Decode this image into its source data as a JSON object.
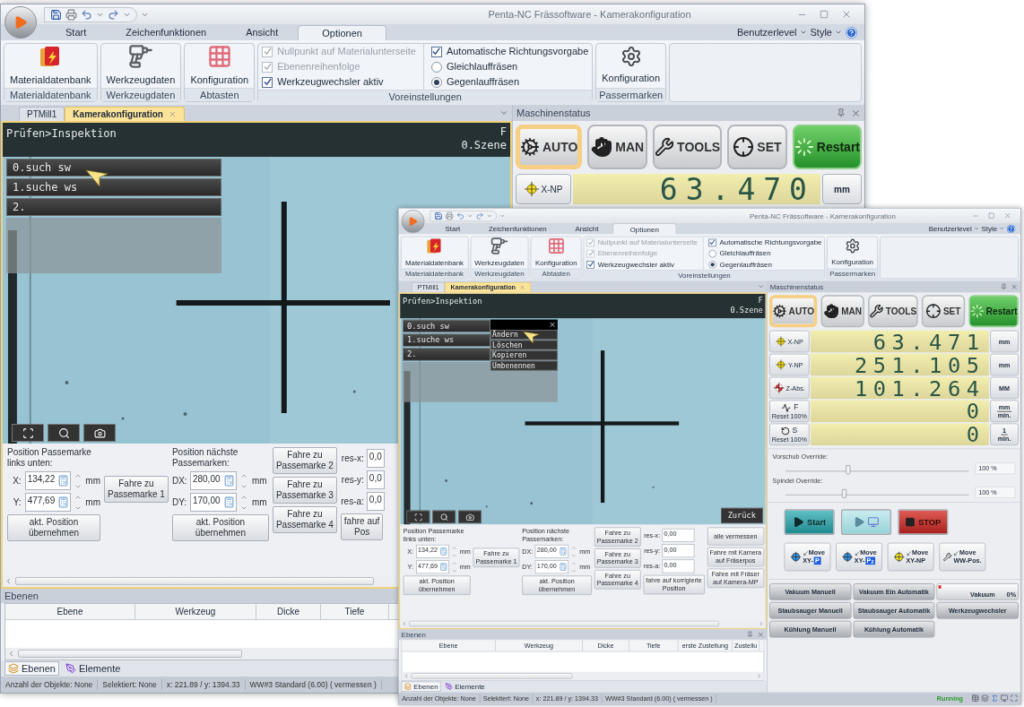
{
  "back_window": {
    "title": "Penta-NC Frässoftware - Kamerakonfiguration",
    "ribbon_tabs": [
      {
        "label": "Start",
        "selected": false
      },
      {
        "label": "Zeichenfunktionen",
        "selected": false
      },
      {
        "label": "Ansicht",
        "selected": false
      },
      {
        "label": "Optionen",
        "selected": true
      }
    ],
    "ribbon_right": [
      "Benutzerlevel",
      "Style"
    ],
    "ribbon_groups": [
      {
        "kind": "material",
        "label": "Materialdatenbank",
        "button": "Materialdatenbank"
      },
      {
        "kind": "tools",
        "label": "Werkzeugdaten",
        "button": "Werkzeugdaten"
      },
      {
        "kind": "probe",
        "label": "Abtasten",
        "button": "Konfiguration"
      },
      {
        "kind": "options",
        "label": "Voreinstellungen",
        "items": [
          {
            "kind": "checkbox",
            "label": "Nullpunkt auf Materialunterseite",
            "checked": true,
            "disabled": true
          },
          {
            "kind": "checkbox",
            "label": "Ebenenreihenfolge",
            "checked": true,
            "disabled": true
          },
          {
            "kind": "checkbox",
            "label": "Werkzeugwechsler aktiv",
            "checked": true,
            "disabled": false
          },
          {
            "kind": "checkbox",
            "label": "Automatische Richtungsvorgabe",
            "checked": true,
            "disabled": false
          },
          {
            "kind": "radio",
            "label": "Gleichlauffräsen",
            "selected": false
          },
          {
            "kind": "radio",
            "label": "Gegenlauffräsen",
            "selected": true
          }
        ]
      },
      {
        "kind": "marks",
        "label": "Passermarken",
        "button": "Konfiguration"
      }
    ],
    "doc_tabs": [
      {
        "label": "PTMill1",
        "selected": false
      },
      {
        "label": "Kamerakonfiguration",
        "selected": true
      }
    ],
    "camera": {
      "breadcrumb": "Prüfen>Inspektion",
      "scene_lines": [
        "F",
        "0.Szene"
      ],
      "menu": [
        "0.such sw",
        "1.suche ws",
        "2."
      ]
    },
    "form": {
      "groups": [
        {
          "kind": "position",
          "heading": "Position Passemarke links unten:",
          "fields": [
            {
              "label": "X:",
              "value": "134,22",
              "unit": "mm"
            },
            {
              "label": "Y:",
              "value": "477,69",
              "unit": "mm"
            }
          ],
          "button": "akt. Position\nübernehmen"
        },
        {
          "kind": "goto",
          "buttons": [
            "Fahre zu\nPassemarke 1"
          ]
        },
        {
          "kind": "position",
          "heading": "Position nächste Passemarken:",
          "fields": [
            {
              "label": "DX:",
              "value": "280,00",
              "unit": "mm"
            },
            {
              "label": "DY:",
              "value": "170,00",
              "unit": "mm"
            }
          ],
          "button": "akt. Position\nübernehmen"
        },
        {
          "kind": "goto",
          "buttons": [
            "Fahre zu\nPassemarke 2",
            "Fahre zu\nPassemarke 3",
            "Fahre zu\nPassemarke 4"
          ]
        },
        {
          "kind": "results",
          "fields": [
            {
              "label": "res-x:",
              "value": "0,0"
            },
            {
              "label": "res-y:",
              "value": "0,0"
            },
            {
              "label": "res-a:",
              "value": "0,0"
            }
          ],
          "button": "fahre auf\nPos"
        }
      ]
    },
    "machine_status": {
      "title": "Maschinenstatus",
      "modes": [
        {
          "kind": "auto",
          "label": "AUTO",
          "selected": true
        },
        {
          "kind": "man",
          "label": "MAN",
          "selected": false
        },
        {
          "kind": "tools",
          "label": "TOOLS",
          "selected": false
        },
        {
          "kind": "set",
          "label": "SET",
          "selected": false
        },
        {
          "kind": "restart",
          "label": "Restart",
          "selected": false
        }
      ],
      "axes": [
        {
          "kind": "np",
          "label": "X-NP",
          "value": "63.470",
          "unit": "mm"
        }
      ]
    },
    "layers_panel": {
      "title": "Ebenen",
      "columns": [
        "Ebene",
        "Werkzeug",
        "Dicke",
        "Tiefe"
      ]
    },
    "bottom_tabs": [
      {
        "kind": "layers",
        "label": "Ebenen",
        "selected": true
      },
      {
        "kind": "elements",
        "label": "Elemente",
        "selected": false
      }
    ],
    "status_bar": {
      "items": [
        "Anzahl der Objekte: None",
        "Selektiert: None",
        "x:  221.89 / y:  1394.33",
        "WW#3 Standard (6.00) ( vermessen )"
      ]
    }
  },
  "front_window": {
    "title": "Penta-NC Frässoftware - Kamerakonfiguration",
    "ribbon_tabs": [
      {
        "label": "Start",
        "selected": false
      },
      {
        "label": "Zeichenfunktionen",
        "selected": false
      },
      {
        "label": "Ansicht",
        "selected": false
      },
      {
        "label": "Optionen",
        "selected": true
      }
    ],
    "ribbon_right": [
      "Benutzerlevel",
      "Style"
    ],
    "ribbon_groups": [
      {
        "kind": "material",
        "label": "Materialdatenbank",
        "button": "Materialdatenbank"
      },
      {
        "kind": "tools",
        "label": "Werkzeugdaten",
        "button": "Werkzeugdaten"
      },
      {
        "kind": "probe",
        "label": "Abtasten",
        "button": "Konfiguration"
      },
      {
        "kind": "options",
        "label": "Voreinstellungen",
        "items": [
          {
            "kind": "checkbox",
            "label": "Nullpunkt auf Materialunterseite",
            "checked": true,
            "disabled": true
          },
          {
            "kind": "checkbox",
            "label": "Ebenenreihenfolge",
            "checked": true,
            "disabled": true
          },
          {
            "kind": "checkbox",
            "label": "Werkzeugwechsler aktiv",
            "checked": true,
            "disabled": false
          },
          {
            "kind": "checkbox",
            "label": "Automatische Richtungsvorgabe",
            "checked": true,
            "disabled": false
          },
          {
            "kind": "radio",
            "label": "Gleichlauffräsen",
            "selected": false
          },
          {
            "kind": "radio",
            "label": "Gegenlauffräsen",
            "selected": true
          }
        ]
      },
      {
        "kind": "marks",
        "label": "Passermarken",
        "button": "Konfiguration"
      }
    ],
    "doc_tabs": [
      {
        "label": "PTMill1",
        "selected": false
      },
      {
        "label": "Kamerakonfiguration",
        "selected": true
      }
    ],
    "camera": {
      "breadcrumb": "Prüfen>Inspektion",
      "scene_lines": [
        "F",
        "0.Szene"
      ],
      "menu": [
        "0.such sw",
        "1.suche ws",
        "2."
      ],
      "context_menu": [
        "Ändern",
        "Löschen",
        "Kopieren",
        "Umbenennen"
      ],
      "back_button": "Zurück"
    },
    "form": {
      "groups": [
        {
          "kind": "position",
          "heading": "Position Passemarke links unten:",
          "fields": [
            {
              "label": "X:",
              "value": "134,22",
              "unit": "mm"
            },
            {
              "label": "Y:",
              "value": "477,69",
              "unit": "mm"
            }
          ],
          "button": "akt. Position\nübernehmen"
        },
        {
          "kind": "goto",
          "buttons": [
            "Fahre zu\nPassemarke 1"
          ]
        },
        {
          "kind": "position",
          "heading": "Position nächste Passemarken:",
          "fields": [
            {
              "label": "DX:",
              "value": "280,00",
              "unit": "mm"
            },
            {
              "label": "DY:",
              "value": "170,00",
              "unit": "mm"
            }
          ],
          "button": "akt. Position\nübernehmen"
        },
        {
          "kind": "goto",
          "buttons": [
            "Fahre zu\nPassemarke 2",
            "Fahre zu\nPassemarke 3",
            "Fahre zu\nPassemarke 4"
          ]
        },
        {
          "kind": "results",
          "fields": [
            {
              "label": "res-x:",
              "value": "0,00"
            },
            {
              "label": "res-y:",
              "value": "0,00"
            },
            {
              "label": "res-a:",
              "value": "0,00"
            }
          ],
          "button": "fahre auf korrigierte\nPosition"
        },
        {
          "kind": "goto",
          "buttons": [
            "alle vermessen",
            "Fahre mit Kamera\nauf Fräserpos",
            "Fahre mit Fräser\nauf Kamera-MP"
          ]
        }
      ]
    },
    "machine_status": {
      "title": "Maschinenstatus",
      "modes": [
        {
          "kind": "auto",
          "label": "AUTO",
          "selected": true
        },
        {
          "kind": "man",
          "label": "MAN",
          "selected": false
        },
        {
          "kind": "tools",
          "label": "TOOLS",
          "selected": false
        },
        {
          "kind": "set",
          "label": "SET",
          "selected": false
        },
        {
          "kind": "restart",
          "label": "Restart",
          "selected": false
        }
      ],
      "axes": [
        {
          "kind": "np",
          "label": "X-NP",
          "value": "63.471",
          "unit": "mm"
        },
        {
          "kind": "np",
          "label": "Y-NP",
          "value": "251.105",
          "unit": "mm"
        },
        {
          "kind": "abs",
          "label": "Z-Abs.",
          "value": "101.264",
          "unit": "MM"
        },
        {
          "kind": "feed",
          "label": "F",
          "sub": "Reset 100%",
          "value": "0",
          "unit": "mm",
          "unit_denominator": "min."
        },
        {
          "kind": "spindle",
          "label": "S",
          "sub": "Reset 100%",
          "value": "0",
          "unit": "1",
          "unit_denominator": "min."
        }
      ],
      "overrides": [
        {
          "label": "Vorschub Override:",
          "level": 0.34,
          "reading": "100 %"
        },
        {
          "label": "Spindel Override:",
          "level": 0.32,
          "reading": "100 %"
        }
      ],
      "run_buttons": [
        {
          "kind": "start",
          "label": "Start"
        },
        {
          "kind": "simulate"
        },
        {
          "kind": "stop",
          "label": "STOP"
        }
      ],
      "move_buttons": [
        {
          "kind": "p",
          "label": "Move",
          "axis": "XY-",
          "badge": "P"
        },
        {
          "kind": "p",
          "label": "Move",
          "axis": "XY-",
          "badge": "P$_{2}$"
        },
        {
          "kind": "np",
          "label": "Move",
          "axis": "XY-NP"
        },
        {
          "kind": "ww",
          "label": "Move",
          "axis": "WW-Pos."
        }
      ],
      "aux": [
        {
          "kind": "button",
          "label": "Vakuum Manuell"
        },
        {
          "kind": "button",
          "label": "Vakuum Ein Automatik"
        },
        {
          "kind": "gauge",
          "label": "Vakuum",
          "reading": "0%",
          "level": 0.01
        },
        {
          "kind": "button",
          "label": "Staubsauger Manuell"
        },
        {
          "kind": "button",
          "label": "Staubsauger Automatik"
        },
        {
          "kind": "button",
          "label": "Werkzeugwechsler"
        },
        {
          "kind": "button",
          "label": "Kühlung Manuell"
        },
        {
          "kind": "button",
          "label": "Kühlung Automatik"
        }
      ]
    },
    "layers_panel": {
      "title": "Ebenen",
      "panel_buttons": true,
      "columns": [
        "Ebene",
        "Werkzeug",
        "Dicke",
        "Tiefe",
        "erste Zustellung",
        "Zustellu"
      ]
    },
    "bottom_tabs": [
      {
        "kind": "layers",
        "label": "Ebenen",
        "selected": true
      },
      {
        "kind": "elements",
        "label": "Elemente",
        "selected": false
      }
    ],
    "status_bar": {
      "items": [
        "Anzahl der Objekte: None",
        "Selektiert: None",
        "x:  221.89 / y:  1394.33",
        "WW#3 Standard (6.00) ( vermessen )"
      ],
      "state": "Running"
    }
  }
}
